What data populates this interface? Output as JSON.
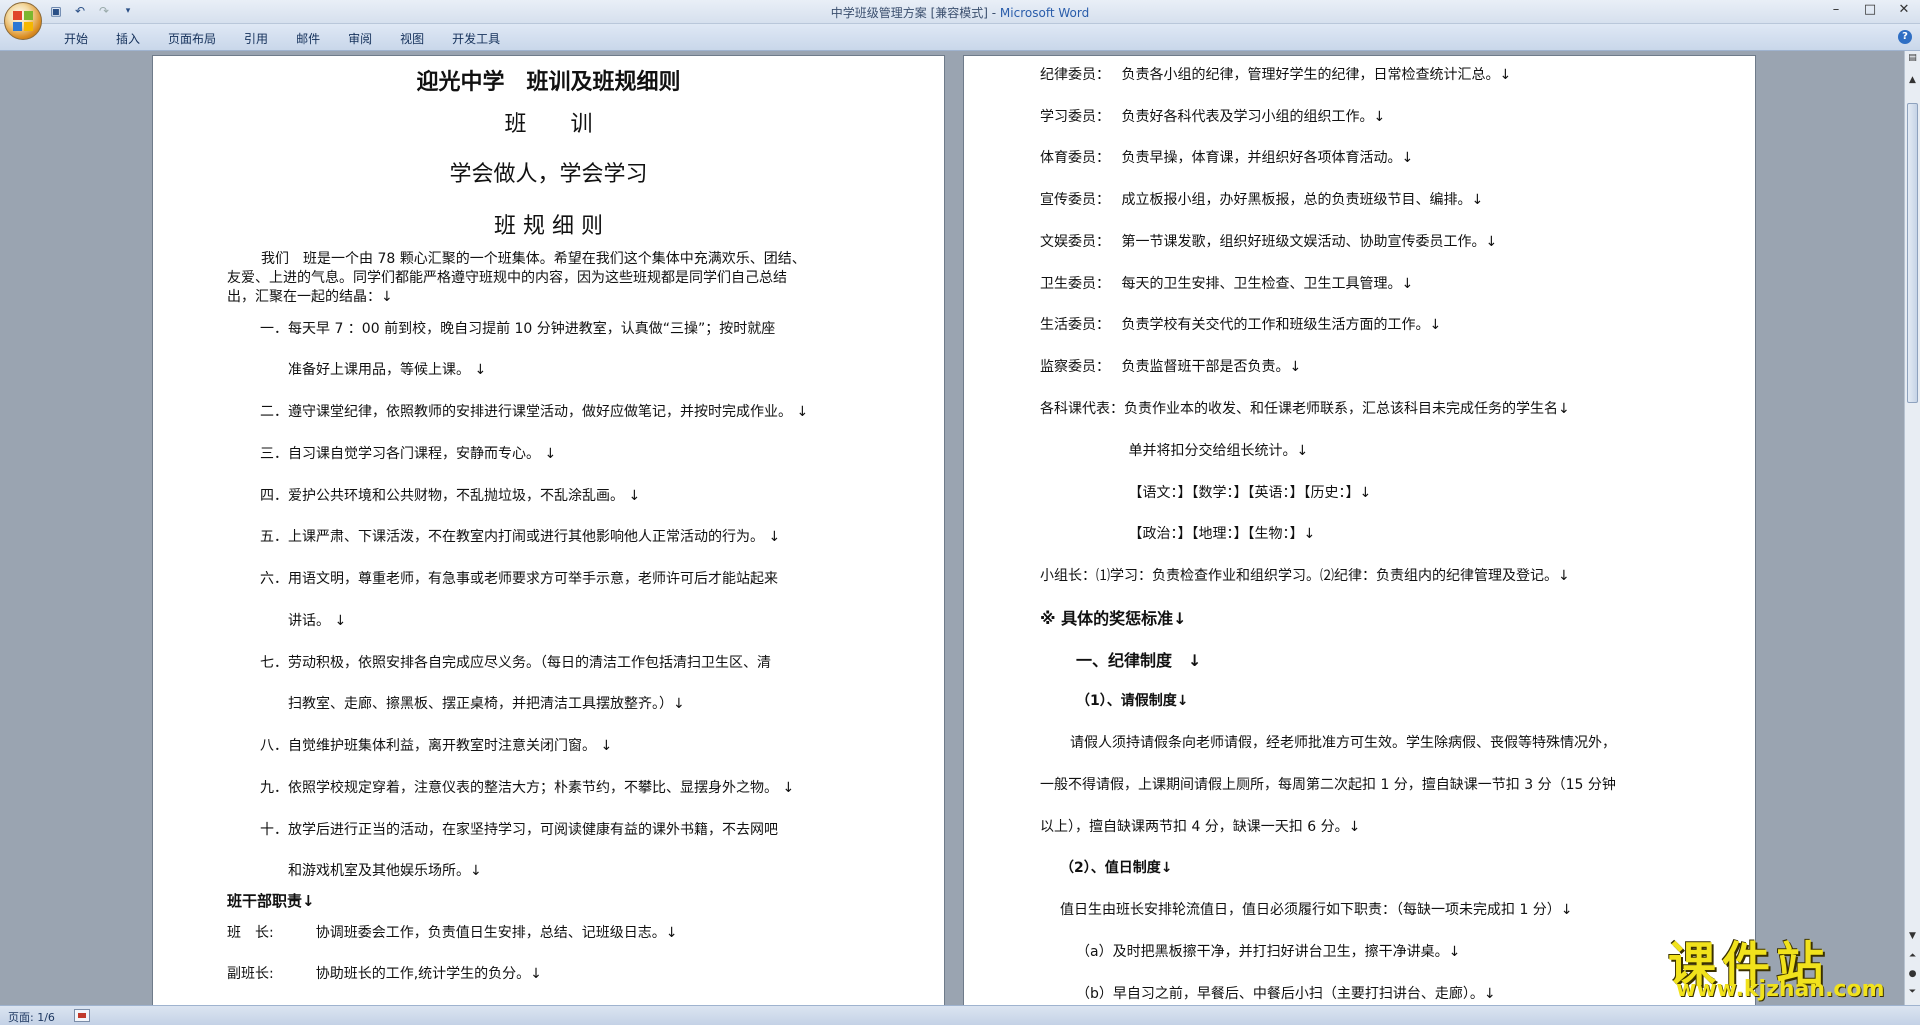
{
  "window": {
    "title": "中学班级管理方案 [兼容模式] - ",
    "app_name": "Microsoft Word",
    "controls": [
      "–",
      "□",
      "✕"
    ]
  },
  "ribbon": {
    "tabs": [
      "开始",
      "插入",
      "页面布局",
      "引用",
      "邮件",
      "审阅",
      "视图",
      "开发工具"
    ]
  },
  "status": {
    "page": "页面: 1/6"
  },
  "watermark": {
    "title": "课件站",
    "url": "www.kjzhan.com"
  },
  "left_page": {
    "title": "迎光中学　班训及班规细则",
    "motto_heading": "班　　训",
    "motto": "学会做人，学会学习",
    "rules_heading": "班 规 细 则",
    "intro": [
      "我们　班是一个由 78 颗心汇聚的一个班集体。希望在我们这个集体中充满欢乐、团结、",
      "友爱、上进的气息。同学们都能严格遵守班规中的内容，因为这些班规都是同学们自己总结",
      "出，汇聚在一起的结晶：↓"
    ],
    "rules": [
      "一．每天早 7 ：00 前到校，晚自习提前 10 分钟进教室，认真做“三操”；按时就座",
      "　　准备好上课用品，等候上课。 ↓",
      "二．遵守课堂纪律，依照教师的安排进行课堂活动，做好应做笔记，并按时完成作业。 ↓",
      "三．自习课自觉学习各门课程，安静而专心。 ↓",
      "四．爱护公共环境和公共财物，不乱抛垃圾，不乱涂乱画。 ↓",
      "五．上课严肃、下课活泼，不在教室内打闹或进行其他影响他人正常活动的行为。 ↓",
      "六．用语文明，尊重老师，有急事或老师要求方可举手示意，老师许可后才能站起来",
      "　　讲话。 ↓",
      "七．劳动积极，依照安排各自完成应尽义务。（每日的清洁工作包括清扫卫生区、清",
      "　　扫教室、走廊、擦黑板、摆正桌椅，并把清洁工具摆放整齐。）↓",
      "八．自觉维护班集体利益，离开教室时注意关闭门窗。 ↓",
      "九．依照学校规定穿着，注意仪表的整洁大方；朴素节约，不攀比、显摆身外之物。 ↓",
      "十．放学后进行正当的活动，在家坚持学习，可阅读健康有益的课外书籍，不去网吧",
      "　　和游戏机室及其他娱乐场所。↓"
    ],
    "cadre_heading": "班干部职责↓",
    "cadre": [
      "班　长:　　　协调班委会工作，负责值日生安排，总结、记班级日志。↓",
      "副班长:　　　协助班长的工作,统计学生的负分。↓"
    ]
  },
  "right_page": {
    "duties": [
      "纪律委员：　 负责各小组的纪律，管理好学生的纪律，日常检查统计汇总。↓",
      "学习委员：　 负责好各科代表及学习小组的组织工作。↓",
      "体育委员：　 负责早操，体育课，并组织好各项体育活动。↓",
      "宣传委员：　 成立板报小组，办好黑板报，总的负责班级节目、编排。↓",
      "文娱委员：　 第一节课发歌，组织好班级文娱活动、协助宣传委员工作。↓",
      "卫生委员：　 每天的卫生安排、卫生检查、卫生工具管理。↓",
      "生活委员：　 负责学校有关交代的工作和班级生活方面的工作。↓",
      "监察委员：　 负责监督班干部是否负责。↓",
      "各科课代表：负责作业本的收发、和任课老师联系，汇总该科目未完成任务的学生名↓",
      "　　　　　　 单并将扣分交给组长统计。↓",
      "　　　　　　 【语文：】【数学：】【英语：】【历史：】↓",
      "　　　　　　 【政治：】【地理：】【生物：】↓",
      "小组长：⑴学习：负责检查作业和组织学习。⑵纪律：负责组内的纪律管理及登记。↓"
    ],
    "section_heading": "※ 具体的奖惩标准↓",
    "sub_heading": "一、纪律制度　↓",
    "leave_heading": "（1）、请假制度↓",
    "leave_text": [
      "　请假人须持请假条向老师请假，经老师批准方可生效。学生除病假、丧假等特殊情况外，",
      "一般不得请假，上课期间请假上厕所，每周第二次起扣 1 分，擅自缺课一节扣 3 分（15 分钟",
      "以上），擅自缺课两节扣 4 分，缺课一天扣 6 分。↓"
    ],
    "duty_heading": "（2）、值日制度↓",
    "duty_text": [
      "值日生由班长安排轮流值日，值日必须履行如下职责：（每缺一项未完成扣 1 分）↓",
      "（a）及时把黑板擦干净，并打扫好讲台卫生，擦干净讲桌。↓",
      "（b）早自习之前，早餐后、中餐后小扫（主要打扫讲台、走廊）。↓"
    ]
  }
}
